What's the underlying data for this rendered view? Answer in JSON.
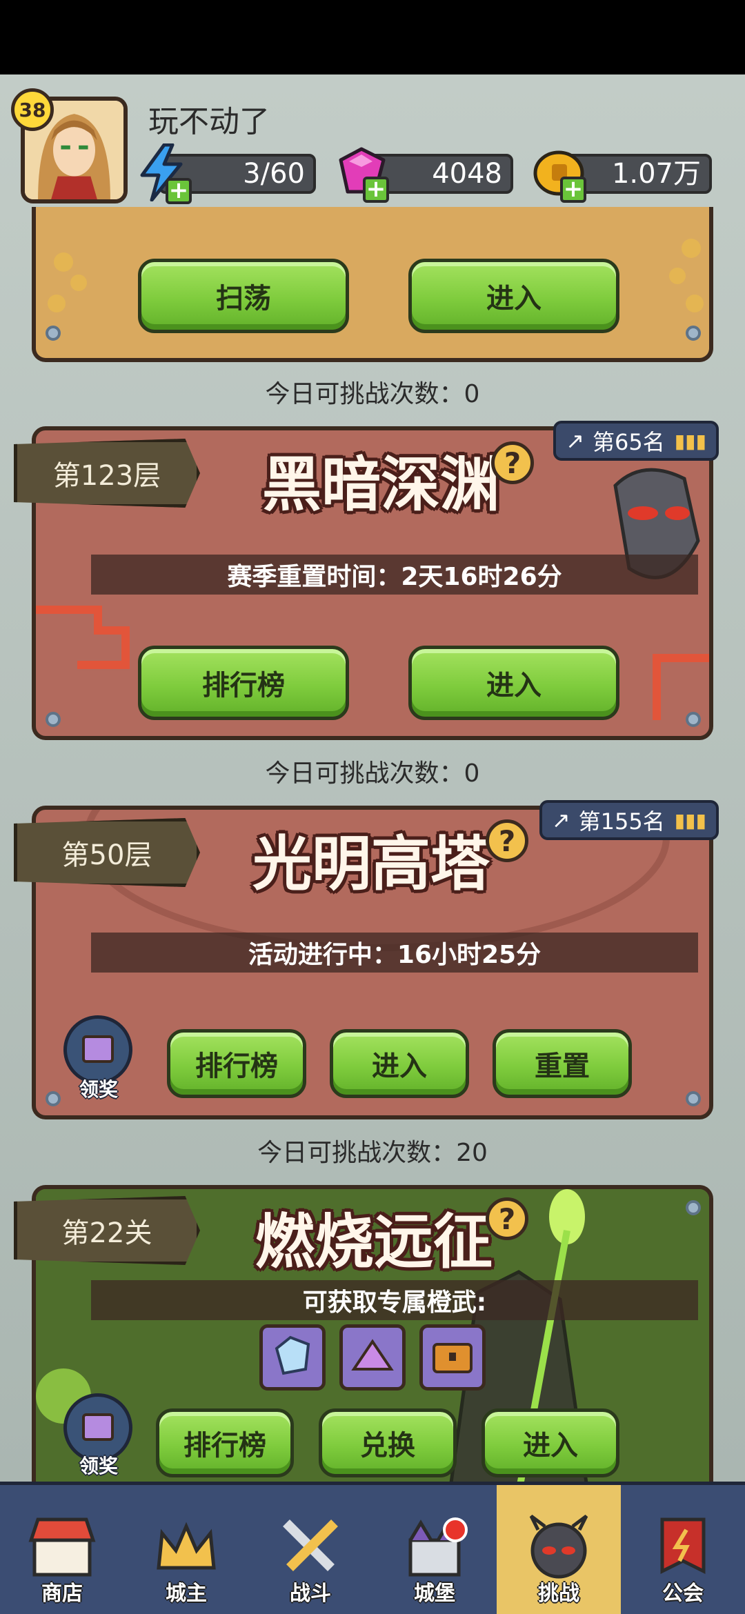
{
  "player": {
    "level": "38",
    "name": "玩不动了"
  },
  "resources": {
    "energy": "3/60",
    "gems": "4048",
    "gold": "1.07万"
  },
  "sweep_card": {
    "sweep_label": "扫荡",
    "enter_label": "进入",
    "attempts": "今日可挑战次数：0"
  },
  "abyss_card": {
    "floor": "第123层",
    "title": "黑暗深渊",
    "rank": "第65名",
    "info": "赛季重置时间：2天16时26分",
    "leaderboard_label": "排行榜",
    "enter_label": "进入",
    "attempts": "今日可挑战次数：0"
  },
  "tower_card": {
    "floor": "第50层",
    "title": "光明高塔",
    "rank": "第155名",
    "info": "活动进行中：16小时25分",
    "reward_label": "领奖",
    "leaderboard_label": "排行榜",
    "enter_label": "进入",
    "reset_label": "重置",
    "attempts": "今日可挑战次数：20"
  },
  "expedition_card": {
    "stage": "第22关",
    "title": "燃烧远征",
    "info": "可获取专属橙武:",
    "reward_label": "领奖",
    "leaderboard_label": "排行榜",
    "exchange_label": "兑换",
    "enter_label": "进入"
  },
  "bottom_nav": {
    "items": [
      {
        "label": "商店",
        "icon": "shop-icon"
      },
      {
        "label": "城主",
        "icon": "crown-icon"
      },
      {
        "label": "战斗",
        "icon": "crossed-swords-icon"
      },
      {
        "label": "城堡",
        "icon": "castle-icon"
      },
      {
        "label": "挑战",
        "icon": "demon-icon"
      },
      {
        "label": "公会",
        "icon": "guild-banner-icon"
      }
    ],
    "active": "挑战"
  },
  "colors": {
    "button_green": "#7fcc3d",
    "card_red": "#b26a5d",
    "nav_blue": "#3b4d73",
    "nav_active": "#e9c566"
  }
}
